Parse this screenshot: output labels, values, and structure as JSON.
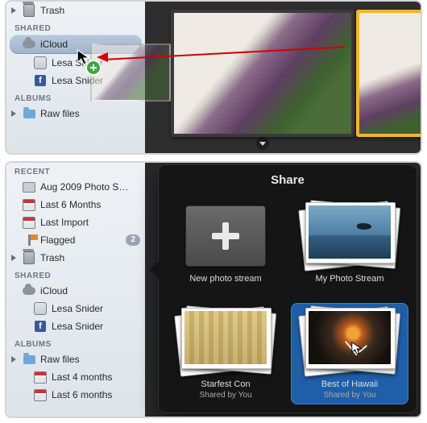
{
  "top": {
    "sidebar": {
      "trash": "Trash",
      "shared_head": "Shared",
      "icloud": "iCloud",
      "lesa1": "Lesa Snider",
      "lesa2": "Lesa Snider",
      "albums_head": "Albums",
      "raw": "Raw files"
    }
  },
  "bottom": {
    "sidebar": {
      "recent_head": "Recent",
      "aug": "Aug 2009 Photo S…",
      "last6": "Last 6 Months",
      "lastimport": "Last Import",
      "flagged": "Flagged",
      "flagged_badge": "2",
      "trash": "Trash",
      "shared_head": "Shared",
      "icloud": "iCloud",
      "lesa1": "Lesa Snider",
      "lesa2": "Lesa Snider",
      "albums_head": "Albums",
      "raw": "Raw files",
      "last4": "Last 4 months",
      "last6b": "Last 6 months"
    },
    "share": {
      "title": "Share",
      "new_stream": "New photo stream",
      "my_stream": "My Photo Stream",
      "starfest": "Starfest Con",
      "starfest_sub": "Shared by You",
      "hawaii": "Best of Hawaii",
      "hawaii_sub": "Shared by You"
    }
  }
}
